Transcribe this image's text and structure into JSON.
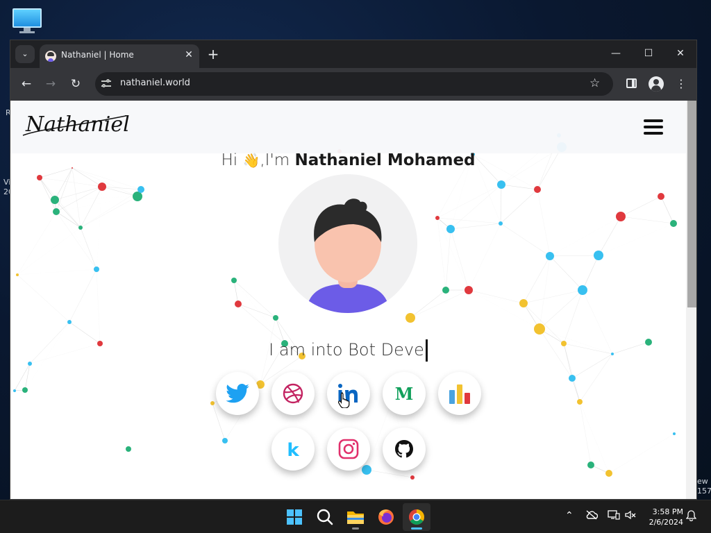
{
  "desktop": {
    "peek_left_1": "R",
    "peek_left_2": "Vi",
    "peek_left_3": "20",
    "peek_right_1": "ew",
    "peek_right_2": "157"
  },
  "browser": {
    "tab": {
      "title": "Nathaniel | Home",
      "favicon": "avatar-favicon"
    },
    "url": "nathaniel.world",
    "window_controls": [
      "minimize",
      "maximize",
      "close"
    ]
  },
  "site": {
    "logo_text": "Nathaniel",
    "greeting": {
      "prefix": "Hi",
      "emoji": "👋",
      "middle": ",I'm",
      "name": "Nathaniel Mohamed"
    },
    "typed_text": "I am into Bot Deve",
    "social_links": [
      {
        "name": "twitter",
        "color": "#1da1f2"
      },
      {
        "name": "dribbble",
        "color": "#c32361"
      },
      {
        "name": "linkedin",
        "color": "#0a66c2"
      },
      {
        "name": "medium",
        "letter": "M",
        "color": "#12a05c"
      },
      {
        "name": "stats",
        "colors": [
          "#4aa3df",
          "#f2c230",
          "#e0393e"
        ]
      },
      {
        "name": "kaggle",
        "letter": "k",
        "color": "#20beff"
      },
      {
        "name": "instagram",
        "color": "#e1306c"
      },
      {
        "name": "github",
        "color": "#111111"
      }
    ]
  },
  "taskbar": {
    "apps": [
      "start",
      "search",
      "file-explorer",
      "firefox",
      "chrome"
    ],
    "time": "3:58 PM",
    "date": "2/6/2024"
  }
}
